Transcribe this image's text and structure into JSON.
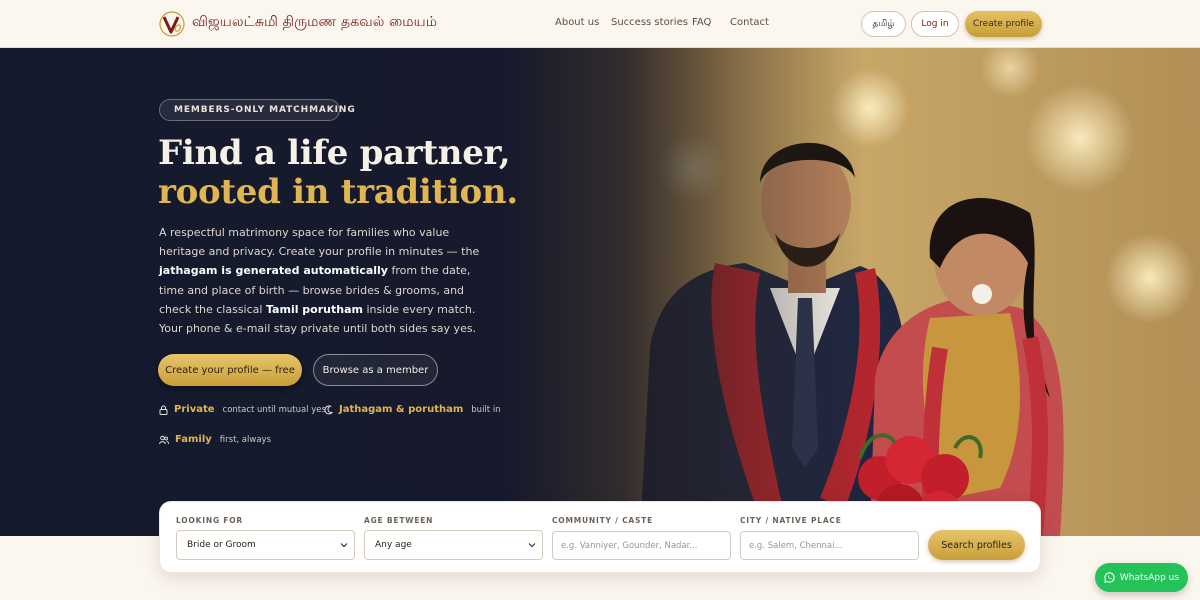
{
  "header": {
    "brand_name": "விஜயலட்சுமி திருமண தகவல் மையம்",
    "logo_letter": "V",
    "nav": [
      "About us",
      "Success stories",
      "FAQ",
      "Contact"
    ],
    "lang_label": "தமிழ்",
    "login_label": "Log in",
    "create_label": "Create profile"
  },
  "hero": {
    "badge": "MEMBERS-ONLY MATCHMAKING",
    "title_line1": "Find a life partner,",
    "title_line2": "rooted in tradition.",
    "desc": [
      {
        "text": "A respectful matrimony space for families who value heritage and privacy. Create your profile in minutes — the ",
        "bold": false
      },
      {
        "text": "jathagam is generated automatically",
        "bold": true
      },
      {
        "text": " from the date, time and place of birth — browse brides & grooms, and check the classical ",
        "bold": false
      },
      {
        "text": "Tamil porutham",
        "bold": true
      },
      {
        "text": " inside every match. Your phone & e-mail stay private until both sides say yes.",
        "bold": false
      }
    ],
    "cta_primary": "Create your profile — free",
    "cta_secondary": "Browse as a member",
    "features": [
      {
        "icon": "lock-icon",
        "title": "Private",
        "sub": "contact until mutual yes"
      },
      {
        "icon": "moon-icon",
        "title": "Jathagam & porutham",
        "sub": "built in"
      },
      {
        "icon": "users-icon",
        "title": "Family",
        "sub": "first, always"
      }
    ]
  },
  "search": {
    "looking_for": {
      "label": "LOOKING FOR",
      "value": "Bride or Groom"
    },
    "age": {
      "label": "AGE BETWEEN",
      "value": "Any age"
    },
    "community": {
      "label": "COMMUNITY / CASTE",
      "placeholder": "e.g. Vanniyer, Gounder, Nadar..."
    },
    "city": {
      "label": "CITY / NATIVE PLACE",
      "placeholder": "e.g. Salem, Chennai..."
    },
    "button": "Search profiles"
  },
  "whatsapp": {
    "label": "WhatsApp us"
  },
  "colors": {
    "gold": "#e1b553",
    "maroon": "#7a1c16",
    "navy": "#15192c",
    "cream": "#fbf6ee",
    "whatsapp": "#25c25a"
  }
}
